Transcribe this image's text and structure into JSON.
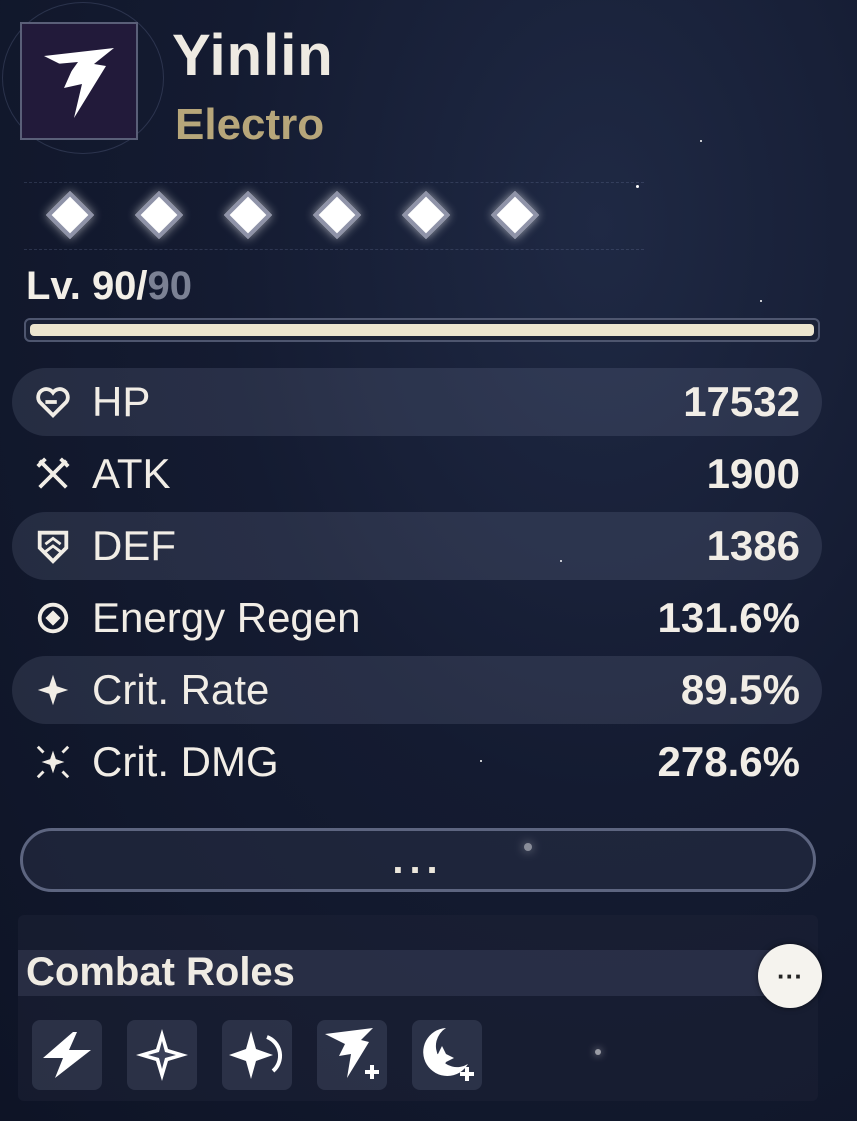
{
  "character": {
    "name": "Yinlin",
    "element": "Electro",
    "element_color": "#b7a67a",
    "emblem_icon": "electro-emblem-icon"
  },
  "constellations": {
    "count": 6,
    "unlocked": 6
  },
  "level": {
    "prefix": "Lv. 90/",
    "max": "90",
    "progress": 1.0
  },
  "stats": [
    {
      "icon": "heart-icon",
      "label": "HP",
      "value": "17532"
    },
    {
      "icon": "crossed-swords-icon",
      "label": "ATK",
      "value": "1900"
    },
    {
      "icon": "shield-icon",
      "label": "DEF",
      "value": "1386"
    },
    {
      "icon": "energy-regen-icon",
      "label": "Energy Regen",
      "value": "131.6%"
    },
    {
      "icon": "sparkle-icon",
      "label": "Crit. Rate",
      "value": "89.5%"
    },
    {
      "icon": "multi-sparkle-icon",
      "label": "Crit. DMG",
      "value": "278.6%"
    }
  ],
  "more_button": {
    "label": "..."
  },
  "combat_roles": {
    "title": "Combat Roles",
    "info_label": "···",
    "roles": [
      {
        "icon": "lightning-bolt-icon"
      },
      {
        "icon": "four-point-star-icon"
      },
      {
        "icon": "star-swirl-icon"
      },
      {
        "icon": "electro-plus-icon"
      },
      {
        "icon": "crescent-plus-icon"
      }
    ]
  }
}
